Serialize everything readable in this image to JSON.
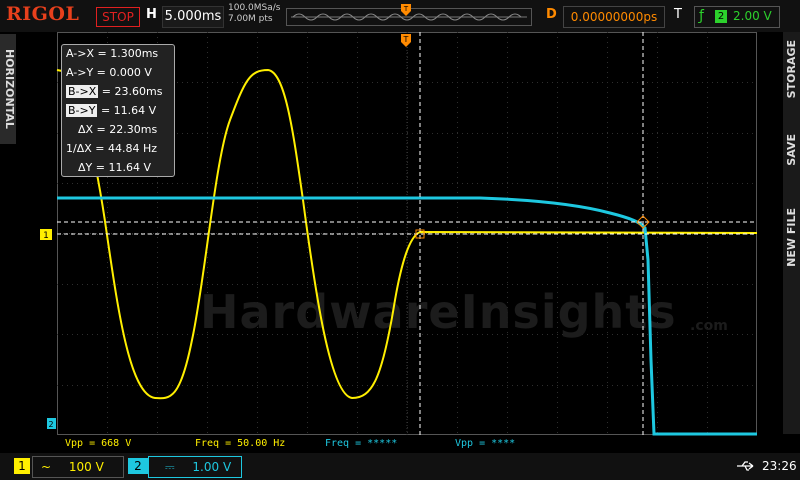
{
  "top": {
    "logo": "RIGOL",
    "run_status": "STOP",
    "h_label": "H",
    "timebase": "5.000ms",
    "sample_rate": "100.0MSa/s",
    "mem_depth": "7.00M pts",
    "trig_marker": "T",
    "d_label": "D",
    "delay": "0.00000000ps",
    "t_label": "T",
    "trig_channel": "2",
    "trig_level": "2.00 V"
  },
  "side": {
    "horizontal": "HORIZONTAL",
    "storage": "STORAGE",
    "save": "SAVE",
    "new_file": "NEW FILE"
  },
  "cursor": {
    "ax": "A->X = 1.300ms",
    "ay": "A->Y = 0.000 V",
    "bx_label": "B->X",
    "bx_val": "= 23.60ms",
    "by_label": "B->Y",
    "by_val": "= 11.64 V",
    "dx": "ΔX = 22.30ms",
    "inv_dx": "1/ΔX = 44.84 Hz",
    "dy": "ΔY = 11.64 V"
  },
  "measurements": {
    "vpp1": "Vpp = 668 V",
    "freq1": "Freq = 50.00 Hz",
    "freq2": "Freq = *****",
    "vpp2": "Vpp = ****"
  },
  "markers": {
    "ch1_level": "1",
    "ch2_level": "2",
    "trig_top": "T"
  },
  "bottom": {
    "ch1_num": "1",
    "ch1_coupling": "~",
    "ch1_scale": "100 V",
    "ch2_num": "2",
    "ch2_coupling": "⎓",
    "ch2_scale": "1.00 V",
    "time": "23:26"
  },
  "watermark": {
    "text": "HardwareInsights",
    "suffix": ".com"
  },
  "colors": {
    "ch1": "#ffef00",
    "ch2": "#1ec8e0",
    "accent": "#ff8a00",
    "logo": "#e8401c",
    "trigger": "#2cd12c"
  }
}
